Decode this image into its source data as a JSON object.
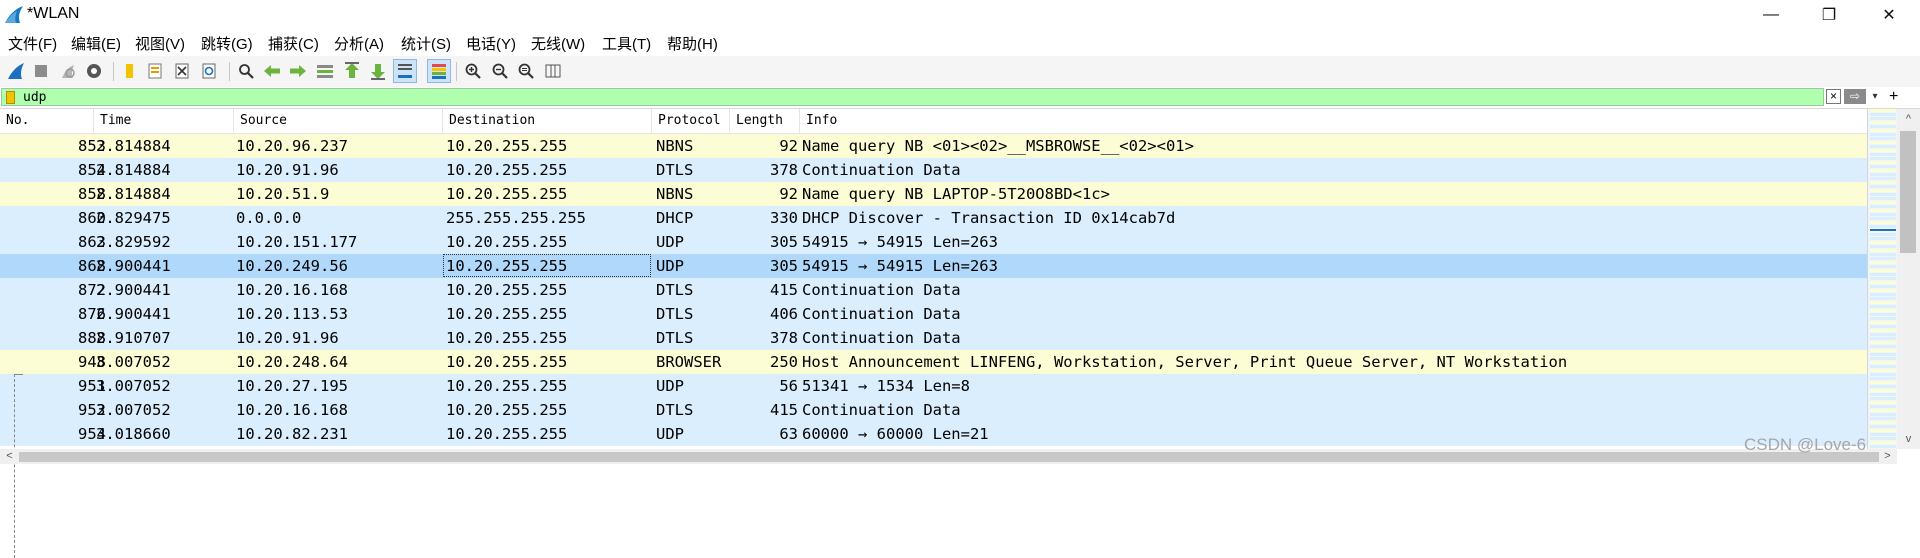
{
  "window": {
    "title": "*WLAN",
    "icon": "wireshark-fin-icon",
    "controls": {
      "minimize": "—",
      "maximize": "❐",
      "close": "✕"
    }
  },
  "menu": [
    "文件(F)",
    "编辑(E)",
    "视图(V)",
    "跳转(G)",
    "捕获(C)",
    "分析(A)",
    "统计(S)",
    "电话(Y)",
    "无线(W)",
    "工具(T)",
    "帮助(H)"
  ],
  "toolbar": {
    "icons": [
      "start-capture-icon",
      "stop-capture-icon",
      "restart-capture-icon",
      "capture-options-icon",
      "open-file-icon",
      "save-file-icon",
      "close-file-icon",
      "reload-file-icon",
      "find-packet-icon",
      "go-back-icon",
      "go-forward-icon",
      "go-to-packet-icon",
      "first-packet-icon",
      "last-packet-icon",
      "autoscroll-icon",
      "colorize-icon",
      "zoom-in-icon",
      "zoom-out-icon",
      "normal-size-icon",
      "resize-columns-icon"
    ]
  },
  "filter": {
    "value": "udp",
    "clear_icon": "×",
    "apply_icon": "⇨",
    "dropdown_icon": "▾",
    "add_icon": "+"
  },
  "columns": [
    "No.",
    "Time",
    "Source",
    "Destination",
    "Protocol",
    "Length",
    "Info"
  ],
  "packets": [
    {
      "no": "853",
      "time": "2.814884",
      "src": "10.20.96.237",
      "dst": "10.20.255.255",
      "proto": "NBNS",
      "len": "92",
      "info": "Name query NB <01><02>__MSBROWSE__<02><01>",
      "color": "#fdfdd5"
    },
    {
      "no": "854",
      "time": "2.814884",
      "src": "10.20.91.96",
      "dst": "10.20.255.255",
      "proto": "DTLS",
      "len": "378",
      "info": "Continuation Data",
      "color": "#daeefe"
    },
    {
      "no": "858",
      "time": "2.814884",
      "src": "10.20.51.9",
      "dst": "10.20.255.255",
      "proto": "NBNS",
      "len": "92",
      "info": "Name query NB LAPTOP-5T20O8BD<1c>",
      "color": "#fdfdd5"
    },
    {
      "no": "860",
      "time": "2.829475",
      "src": "0.0.0.0",
      "dst": "255.255.255.255",
      "proto": "DHCP",
      "len": "330",
      "info": "DHCP Discover - Transaction ID 0x14cab7d",
      "color": "#daeefe"
    },
    {
      "no": "863",
      "time": "2.829592",
      "src": "10.20.151.177",
      "dst": "10.20.255.255",
      "proto": "UDP",
      "len": "305",
      "info": "54915 → 54915 Len=263",
      "color": "#daeefe"
    },
    {
      "no": "868",
      "time": "2.900441",
      "src": "10.20.249.56",
      "dst": "10.20.255.255",
      "proto": "UDP",
      "len": "305",
      "info": "54915 → 54915 Len=263",
      "color": "#b0d8fa",
      "selected": true
    },
    {
      "no": "872",
      "time": "2.900441",
      "src": "10.20.16.168",
      "dst": "10.20.255.255",
      "proto": "DTLS",
      "len": "415",
      "info": "Continuation Data",
      "color": "#daeefe"
    },
    {
      "no": "876",
      "time": "2.900441",
      "src": "10.20.113.53",
      "dst": "10.20.255.255",
      "proto": "DTLS",
      "len": "406",
      "info": "Continuation Data",
      "color": "#daeefe"
    },
    {
      "no": "888",
      "time": "2.910707",
      "src": "10.20.91.96",
      "dst": "10.20.255.255",
      "proto": "DTLS",
      "len": "378",
      "info": "Continuation Data",
      "color": "#daeefe"
    },
    {
      "no": "948",
      "time": "3.007052",
      "src": "10.20.248.64",
      "dst": "10.20.255.255",
      "proto": "BROWSER",
      "len": "250",
      "info": "Host Announcement LINFENG, Workstation, Server, Print Queue Server, NT Workstation",
      "color": "#fdfdd5"
    },
    {
      "no": "951",
      "time": "3.007052",
      "src": "10.20.27.195",
      "dst": "10.20.255.255",
      "proto": "UDP",
      "len": "56",
      "info": "51341 → 1534 Len=8",
      "color": "#daeefe"
    },
    {
      "no": "952",
      "time": "3.007052",
      "src": "10.20.16.168",
      "dst": "10.20.255.255",
      "proto": "DTLS",
      "len": "415",
      "info": "Continuation Data",
      "color": "#daeefe"
    },
    {
      "no": "954",
      "time": "3.018660",
      "src": "10.20.82.231",
      "dst": "10.20.255.255",
      "proto": "UDP",
      "len": "63",
      "info": "60000 → 60000 Len=21",
      "color": "#daeefe"
    }
  ],
  "scroll": {
    "up": "^",
    "down": "v",
    "left": "<",
    "right": ">"
  },
  "watermark": "CSDN @Love-6"
}
